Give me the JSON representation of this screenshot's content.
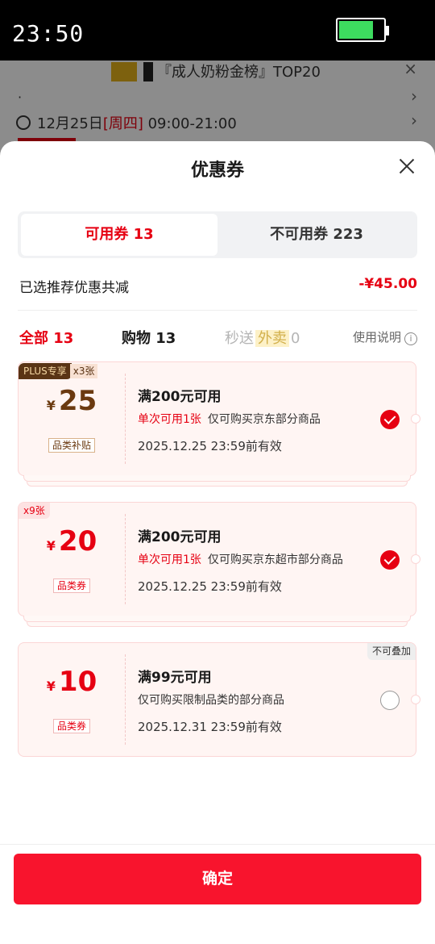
{
  "status_bar": {
    "time": "23:50",
    "battery_color": "#3ddc5f"
  },
  "background_page": {
    "ranking_text": "『成人奶粉金榜』TOP20",
    "delivery_date": "12月25日",
    "delivery_weekday": "[周四]",
    "delivery_hours": "09:00-21:00"
  },
  "sheet": {
    "title": "优惠券",
    "tabs": {
      "available": "可用券 13",
      "unavailable": "不可用券 223"
    },
    "summary": {
      "label": "已选推荐优惠共减",
      "value": "-¥45.00"
    },
    "filters": {
      "all": "全部 13",
      "shopping": "购物 13",
      "secondsend_prefix": "秒送",
      "secondsend_tag": "外卖",
      "secondsend_count": "0",
      "help": "使用说明",
      "help_icon": "i"
    },
    "coupons": [
      {
        "badge_plus": "PLUS专享",
        "badge_count": "x3张",
        "yen": "¥",
        "amount": "25",
        "category": "品类补贴",
        "condition": "满200元可用",
        "limit": "单次可用1张",
        "scope": "仅可购买京东部分商品",
        "expiry": "2025.12.25 23:59前有效",
        "selected": true
      },
      {
        "badge_count": "x9张",
        "yen": "¥",
        "amount": "20",
        "category": "品类券",
        "condition": "满200元可用",
        "limit": "单次可用1张",
        "scope": "仅可购买京东超市部分商品",
        "expiry": "2025.12.25 23:59前有效",
        "selected": true
      },
      {
        "badge_noadd": "不可叠加",
        "yen": "¥",
        "amount": "10",
        "category": "品类券",
        "condition": "满99元可用",
        "scope": "仅可购买限制品类的部分商品",
        "expiry": "2025.12.31 23:59前有效",
        "selected": false
      }
    ],
    "confirm_label": "确定",
    "accent_color": "#e60012"
  }
}
